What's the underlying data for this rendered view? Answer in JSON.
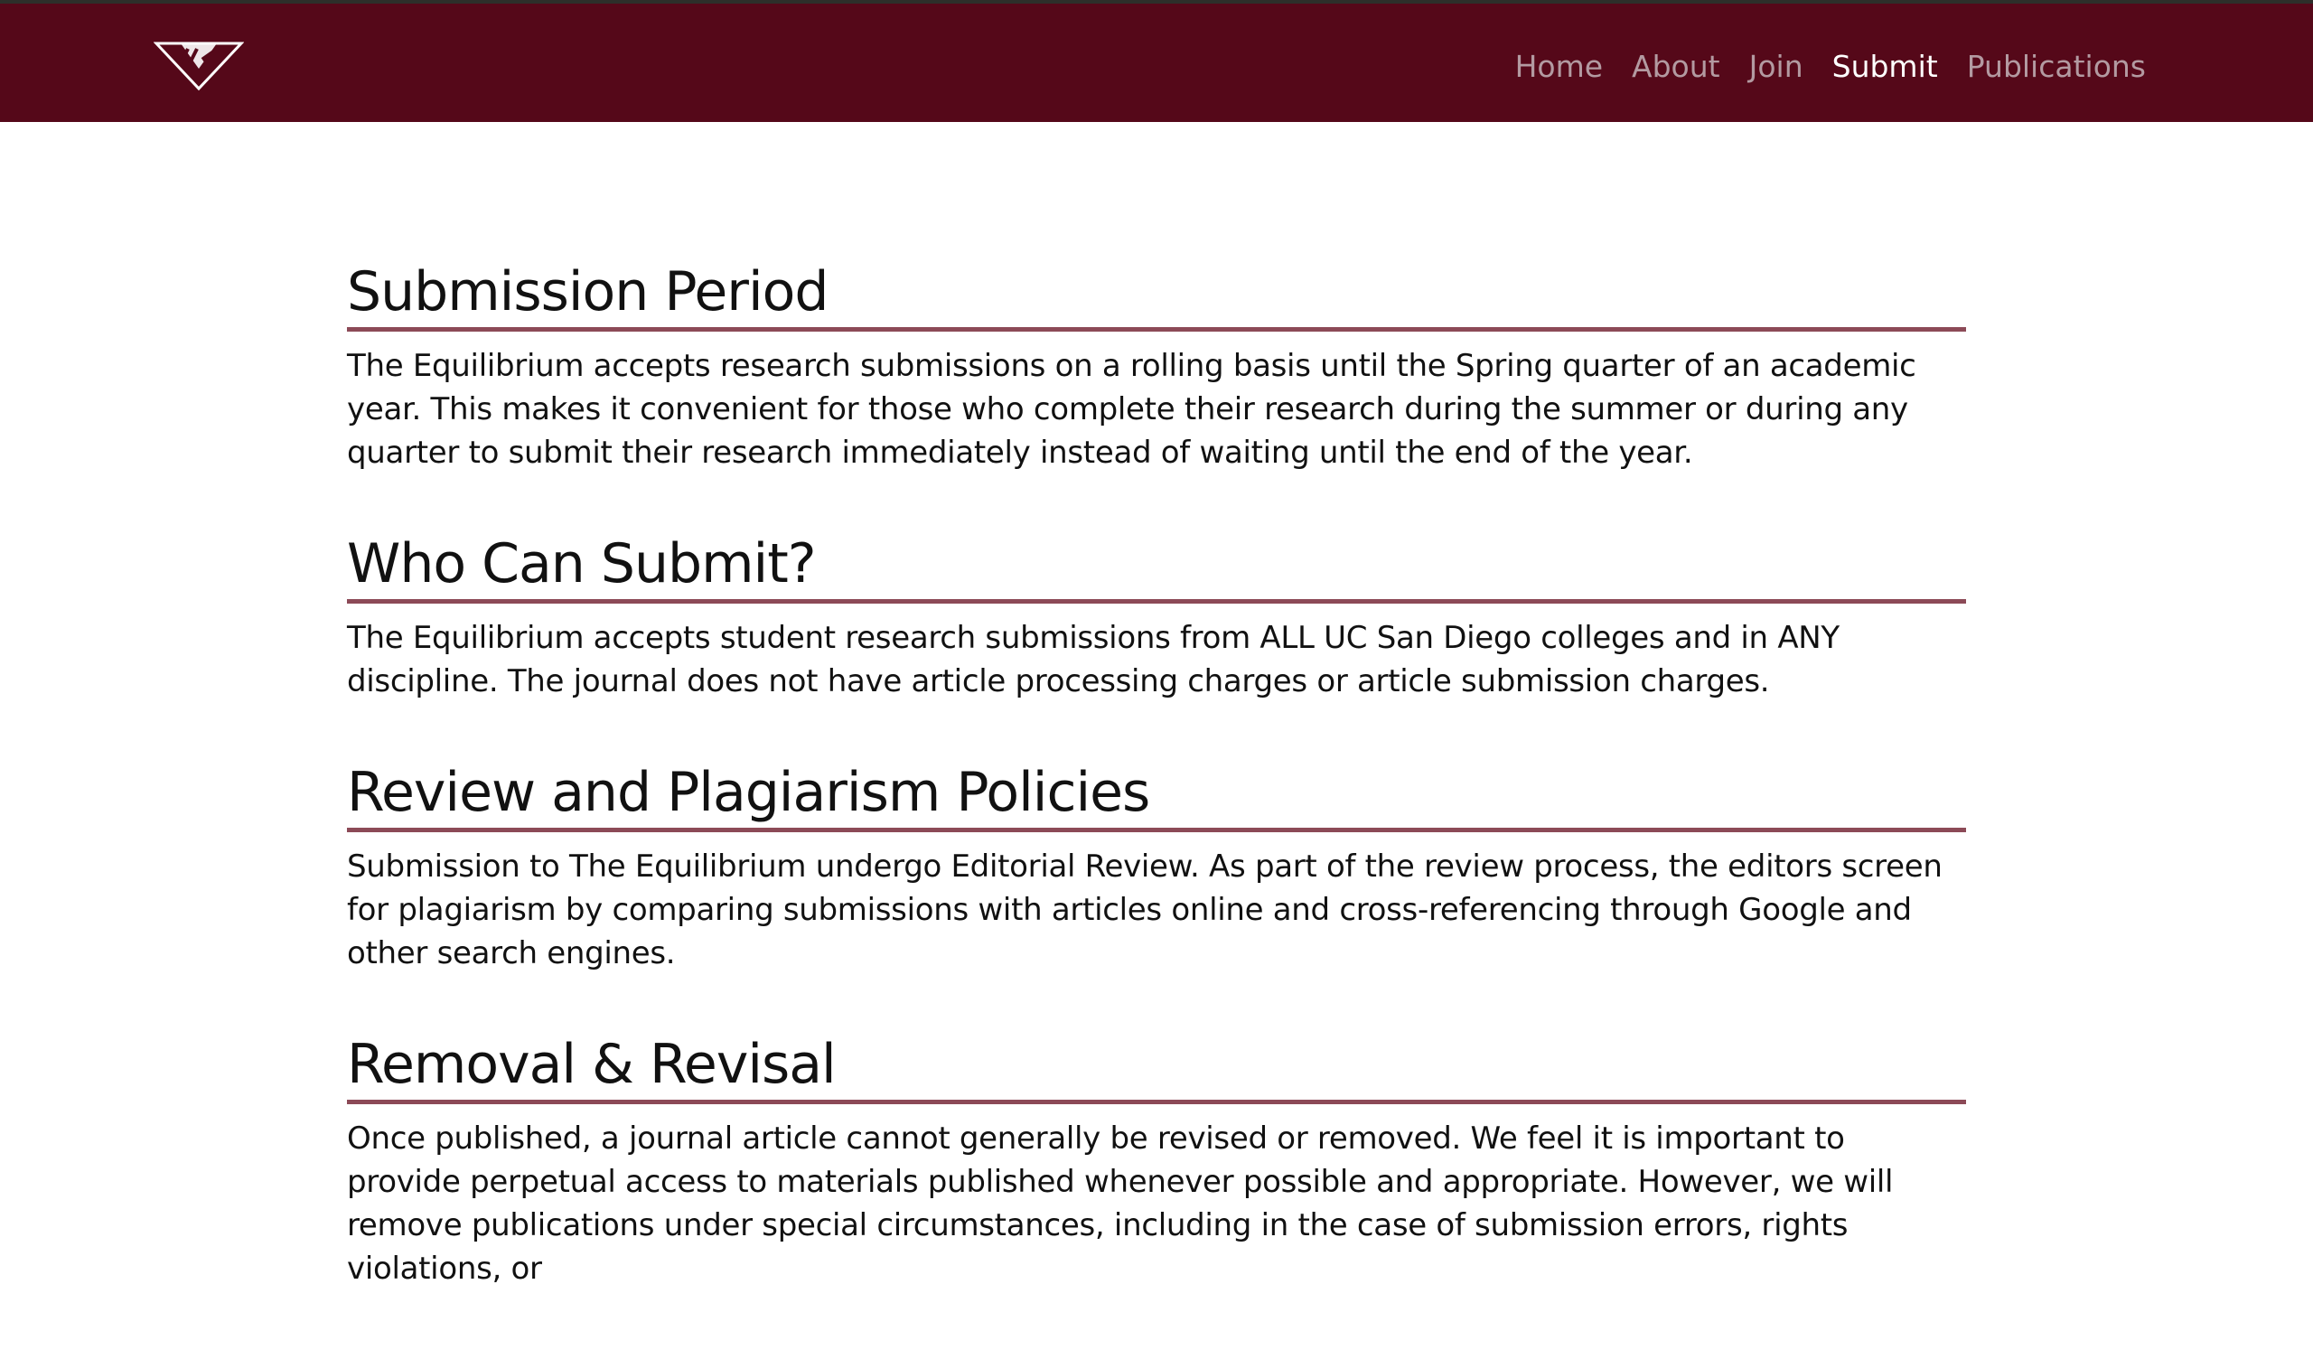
{
  "colors": {
    "navbar_bg": "#550819",
    "nav_link": "#b39aa1",
    "nav_link_active": "#ffffff",
    "rule": "#8c4a57",
    "text": "#111111"
  },
  "header": {
    "logo_icon": "triangle-logo-icon",
    "nav": [
      {
        "label": "Home",
        "active": false
      },
      {
        "label": "About",
        "active": false
      },
      {
        "label": "Join",
        "active": false
      },
      {
        "label": "Submit",
        "active": true
      },
      {
        "label": "Publications",
        "active": false
      }
    ]
  },
  "sections": [
    {
      "title": "Submission Period",
      "body": "The Equilibrium accepts research submissions on a rolling basis until the Spring quarter of an academic year. This makes it convenient for those who complete their research during the summer or during any quarter to submit their research immediately instead of waiting until the end of the year."
    },
    {
      "title": "Who Can Submit?",
      "body": "The Equilibrium accepts student research submissions from ALL UC San Diego colleges and in ANY discipline. The journal does not have article processing charges or article submission charges."
    },
    {
      "title": "Review and Plagiarism Policies",
      "body": "Submission to The Equilibrium undergo Editorial Review. As part of the review process, the editors screen for plagiarism by comparing submissions with articles online and cross-referencing through Google and other search engines."
    },
    {
      "title": "Removal & Revisal",
      "body": "Once published, a journal article cannot generally be revised or removed. We feel it is important to provide perpetual access to materials published whenever possible and appropriate. However, we will remove publications under special circumstances, including in the case of submission errors, rights violations, or"
    }
  ]
}
